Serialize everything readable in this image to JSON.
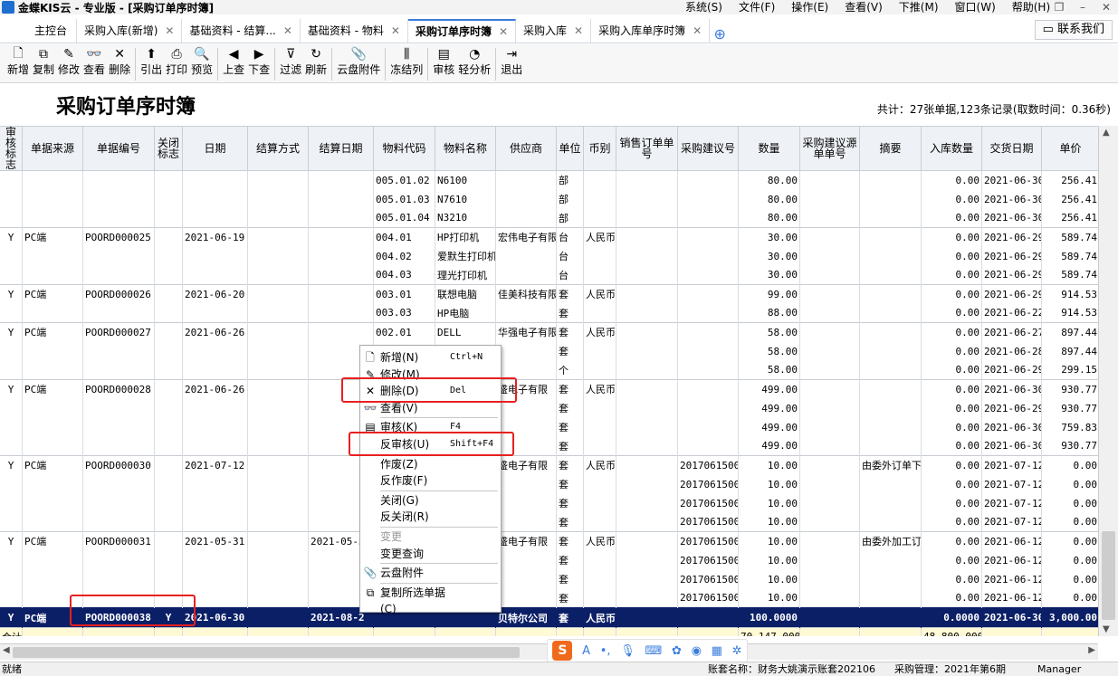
{
  "window": {
    "title": "金蝶KIS云 - 专业版 - [采购订单序时簿]",
    "menus": [
      "系统(S)",
      "文件(F)",
      "操作(E)",
      "查看(V)",
      "下推(M)",
      "窗口(W)",
      "帮助(H)"
    ]
  },
  "tabs": [
    {
      "label": "主控台",
      "closable": false,
      "active": false
    },
    {
      "label": "采购入库(新增)",
      "closable": true,
      "active": false
    },
    {
      "label": "基础资料 - 结算...",
      "closable": true,
      "active": false
    },
    {
      "label": "基础资料 - 物料",
      "closable": true,
      "active": false
    },
    {
      "label": "采购订单序时簿",
      "closable": true,
      "active": true
    },
    {
      "label": "采购入库",
      "closable": true,
      "active": false
    },
    {
      "label": "采购入库单序时簿",
      "closable": true,
      "active": false
    }
  ],
  "contact_button": "联系我们",
  "toolbar": [
    {
      "label": "新增",
      "icon": "new-doc-icon",
      "glyph": "🗋"
    },
    {
      "label": "复制",
      "icon": "copy-icon",
      "glyph": "⧉"
    },
    {
      "label": "修改",
      "icon": "edit-icon",
      "glyph": "✎"
    },
    {
      "label": "查看",
      "icon": "binoculars-icon",
      "glyph": "👓"
    },
    {
      "label": "删除",
      "icon": "delete-icon",
      "glyph": "✕"
    },
    {
      "label": "引出",
      "icon": "export-icon",
      "glyph": "⬆"
    },
    {
      "label": "打印",
      "icon": "print-icon",
      "glyph": "⎙"
    },
    {
      "label": "预览",
      "icon": "preview-icon",
      "glyph": "🔍"
    },
    {
      "label": "上查",
      "icon": "trace-up-icon",
      "glyph": "◀"
    },
    {
      "label": "下查",
      "icon": "trace-down-icon",
      "glyph": "▶"
    },
    {
      "label": "过滤",
      "icon": "filter-icon",
      "glyph": "⊽"
    },
    {
      "label": "刷新",
      "icon": "refresh-icon",
      "glyph": "↻"
    },
    {
      "label": "云盘附件",
      "icon": "cloud-attachment-icon",
      "glyph": "📎"
    },
    {
      "label": "冻结列",
      "icon": "freeze-columns-icon",
      "glyph": "⫼"
    },
    {
      "label": "审核",
      "icon": "audit-icon",
      "glyph": "▤"
    },
    {
      "label": "轻分析",
      "icon": "analysis-icon",
      "glyph": "◔"
    },
    {
      "label": "退出",
      "icon": "exit-icon",
      "glyph": "⇥"
    }
  ],
  "report": {
    "title": "采购订单序时簿",
    "summary": "共计：27张单据,123条记录(取数时间：0.36秒)"
  },
  "columns": [
    "审核标志",
    "单据来源",
    "单据编号",
    "关闭标志",
    "日期",
    "结算方式",
    "结算日期",
    "物料代码",
    "物料名称",
    "供应商",
    "单位",
    "币别",
    "销售订单单号",
    "采购建议号",
    "数量",
    "采购建议源单单号",
    "摘要",
    "入库数量",
    "交货日期",
    "单价"
  ],
  "rows": [
    [
      "",
      "",
      "",
      "",
      "",
      "",
      "",
      "005.01.02",
      "N6100",
      "",
      "部",
      "",
      "",
      "",
      "80.00",
      "",
      "",
      "0.00",
      "2021-06-30",
      "256.41"
    ],
    [
      "",
      "",
      "",
      "",
      "",
      "",
      "",
      "005.01.03",
      "N7610",
      "",
      "部",
      "",
      "",
      "",
      "80.00",
      "",
      "",
      "0.00",
      "2021-06-30",
      "256.41"
    ],
    [
      "",
      "",
      "",
      "",
      "",
      "",
      "",
      "005.01.04",
      "N3210",
      "",
      "部",
      "",
      "",
      "",
      "80.00",
      "",
      "",
      "0.00",
      "2021-06-30",
      "256.41"
    ],
    [
      "Y",
      "PC端",
      "POORD000025",
      "",
      "2021-06-19",
      "",
      "",
      "004.01",
      "HP打印机",
      "宏伟电子有限",
      "台",
      "人民币",
      "",
      "",
      "30.00",
      "",
      "",
      "0.00",
      "2021-06-29",
      "589.74"
    ],
    [
      "",
      "",
      "",
      "",
      "",
      "",
      "",
      "004.02",
      "爱默生打印机",
      "",
      "台",
      "",
      "",
      "",
      "30.00",
      "",
      "",
      "0.00",
      "2021-06-29",
      "589.74"
    ],
    [
      "",
      "",
      "",
      "",
      "",
      "",
      "",
      "004.03",
      "理光打印机",
      "",
      "台",
      "",
      "",
      "",
      "30.00",
      "",
      "",
      "0.00",
      "2021-06-29",
      "589.74"
    ],
    [
      "Y",
      "PC端",
      "POORD000026",
      "",
      "2021-06-20",
      "",
      "",
      "003.01",
      "联想电脑",
      "佳美科技有限",
      "套",
      "人民币",
      "",
      "",
      "99.00",
      "",
      "",
      "0.00",
      "2021-06-29",
      "914.53"
    ],
    [
      "",
      "",
      "",
      "",
      "",
      "",
      "",
      "003.03",
      "HP电脑",
      "",
      "套",
      "",
      "",
      "",
      "88.00",
      "",
      "",
      "0.00",
      "2021-06-22",
      "914.53"
    ],
    [
      "Y",
      "PC端",
      "POORD000027",
      "",
      "2021-06-26",
      "",
      "",
      "002.01",
      "DELL",
      "华强电子有限",
      "套",
      "人民币",
      "",
      "",
      "58.00",
      "",
      "",
      "0.00",
      "2021-06-27",
      "897.44"
    ],
    [
      "",
      "",
      "",
      "",
      "",
      "",
      "",
      "002.02",
      "DELL",
      "",
      "套",
      "",
      "",
      "",
      "58.00",
      "",
      "",
      "0.00",
      "2021-06-28",
      "897.44"
    ],
    [
      "",
      "",
      "",
      "",
      "",
      "",
      "",
      "",
      "",
      "",
      "个",
      "",
      "",
      "",
      "58.00",
      "",
      "",
      "0.00",
      "2021-06-29",
      "299.15"
    ],
    [
      "Y",
      "PC端",
      "POORD000028",
      "",
      "2021-06-26",
      "",
      "",
      "",
      "",
      "盛电子有限",
      "套",
      "人民币",
      "",
      "",
      "499.00",
      "",
      "",
      "0.00",
      "2021-06-30",
      "930.77"
    ],
    [
      "",
      "",
      "",
      "",
      "",
      "",
      "",
      "",
      "",
      "",
      "套",
      "",
      "",
      "",
      "499.00",
      "",
      "",
      "0.00",
      "2021-06-29",
      "930.77"
    ],
    [
      "",
      "",
      "",
      "",
      "",
      "",
      "",
      "",
      "",
      "",
      "套",
      "",
      "",
      "",
      "499.00",
      "",
      "",
      "0.00",
      "2021-06-30",
      "759.83"
    ],
    [
      "",
      "",
      "",
      "",
      "",
      "",
      "",
      "",
      "",
      "",
      "套",
      "",
      "",
      "",
      "499.00",
      "",
      "",
      "0.00",
      "2021-06-30",
      "930.77"
    ],
    [
      "Y",
      "PC端",
      "POORD000030",
      "",
      "2021-07-12",
      "",
      "",
      "",
      "",
      "盛电子有限",
      "套",
      "人民币",
      "",
      "20170615002",
      "10.00",
      "",
      "由委外订单下",
      "0.00",
      "2021-07-12",
      "0.00"
    ],
    [
      "",
      "",
      "",
      "",
      "",
      "",
      "",
      "",
      "",
      "",
      "套",
      "",
      "",
      "20170615002",
      "10.00",
      "",
      "",
      "0.00",
      "2021-07-12",
      "0.00"
    ],
    [
      "",
      "",
      "",
      "",
      "",
      "",
      "",
      "",
      "",
      "",
      "套",
      "",
      "",
      "20170615002",
      "10.00",
      "",
      "",
      "0.00",
      "2021-07-12",
      "0.00"
    ],
    [
      "",
      "",
      "",
      "",
      "",
      "",
      "",
      "",
      "",
      "",
      "套",
      "",
      "",
      "20170615002",
      "10.00",
      "",
      "",
      "0.00",
      "2021-07-12",
      "0.00"
    ],
    [
      "Y",
      "PC端",
      "POORD000031",
      "",
      "2021-05-31",
      "",
      "2021-05-31",
      "",
      "",
      "盛电子有限",
      "套",
      "人民币",
      "",
      "20170615003",
      "10.00",
      "",
      "由委外加工订",
      "0.00",
      "2021-06-12",
      "0.00"
    ],
    [
      "",
      "",
      "",
      "",
      "",
      "",
      "",
      "",
      "",
      "",
      "套",
      "",
      "",
      "20170615003",
      "10.00",
      "",
      "",
      "0.00",
      "2021-06-12",
      "0.00"
    ],
    [
      "",
      "",
      "",
      "",
      "",
      "",
      "",
      "",
      "",
      "",
      "套",
      "",
      "",
      "20170615003",
      "10.00",
      "",
      "",
      "0.00",
      "2021-06-12",
      "0.00"
    ],
    [
      "",
      "",
      "",
      "",
      "",
      "",
      "",
      "",
      "",
      "",
      "套",
      "",
      "",
      "20170615003",
      "10.00",
      "",
      "",
      "0.00",
      "2021-06-12",
      "0.00"
    ]
  ],
  "group_starts": [
    0,
    3,
    6,
    8,
    11,
    15,
    19
  ],
  "selected_row": [
    "Y",
    "PC端",
    "POORD000038",
    "Y",
    "2021-06-30",
    "",
    "2021-08-2",
    "",
    "",
    "贝特尔公司",
    "套",
    "人民币",
    "",
    "",
    "100.0000",
    "",
    "",
    "0.0000",
    "2021-06-30",
    "3,000.00"
  ],
  "total_row": [
    "合计:",
    "",
    "",
    "",
    "",
    "",
    "",
    "",
    "",
    "",
    "",
    "",
    "",
    "",
    "70,147.0000",
    "",
    "",
    "48,800.0000",
    "",
    ""
  ],
  "context_menu": [
    {
      "label": "新增(N)",
      "shortcut": "Ctrl+N",
      "icon": "new-doc-icon",
      "glyph": "🗋",
      "disabled": false
    },
    {
      "label": "修改(M)",
      "shortcut": "",
      "icon": "edit-icon",
      "glyph": "✎",
      "disabled": false
    },
    {
      "label": "删除(D)",
      "shortcut": "Del",
      "icon": "delete-icon",
      "glyph": "✕",
      "disabled": false
    },
    {
      "label": "查看(V)",
      "shortcut": "",
      "icon": "binoculars-icon",
      "glyph": "👓",
      "disabled": false
    },
    {
      "sep": true
    },
    {
      "label": "审核(K)",
      "shortcut": "F4",
      "icon": "audit-icon",
      "glyph": "▤",
      "disabled": false
    },
    {
      "label": "反审核(U)",
      "shortcut": "Shift+F4",
      "icon": "",
      "glyph": "",
      "disabled": false
    },
    {
      "sep": true
    },
    {
      "label": "作废(Z)",
      "shortcut": "",
      "icon": "",
      "glyph": "",
      "disabled": false
    },
    {
      "label": "反作废(F)",
      "shortcut": "",
      "icon": "",
      "glyph": "",
      "disabled": false
    },
    {
      "sep": true
    },
    {
      "label": "关闭(G)",
      "shortcut": "",
      "icon": "",
      "glyph": "",
      "disabled": false
    },
    {
      "label": "反关闭(R)",
      "shortcut": "",
      "icon": "",
      "glyph": "",
      "disabled": false
    },
    {
      "sep": true
    },
    {
      "label": "变更",
      "shortcut": "",
      "icon": "",
      "glyph": "",
      "disabled": true
    },
    {
      "label": "变更查询",
      "shortcut": "",
      "icon": "",
      "glyph": "",
      "disabled": false
    },
    {
      "sep": true
    },
    {
      "label": "云盘附件",
      "shortcut": "",
      "icon": "cloud-attachment-icon",
      "glyph": "📎",
      "disabled": false
    },
    {
      "sep": true
    },
    {
      "label": "复制所选单据(C)",
      "shortcut": "",
      "icon": "copy-icon",
      "glyph": "⧉",
      "disabled": false
    }
  ],
  "statusbar": {
    "state": "就绪",
    "account": "账套名称：财务大姚演示账套202106",
    "period": "采购管理：2021年第6期",
    "user": "Manager"
  },
  "colors": {
    "selected_row_bg": "#0b1f66",
    "total_row_bg": "#fff9d6",
    "highlight_box": "#e82020",
    "accent": "#3b7ddd"
  }
}
